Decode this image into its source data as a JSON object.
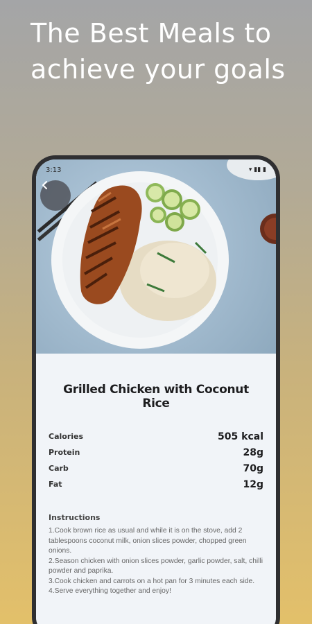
{
  "headline": "The Best Meals to achieve your goals",
  "status": {
    "time": "3:13"
  },
  "recipe": {
    "title": "Grilled Chicken with Coconut Rice",
    "nutrition": [
      {
        "label": "Calories",
        "value": "505 kcal"
      },
      {
        "label": "Protein",
        "value": "28g"
      },
      {
        "label": "Carb",
        "value": "70g"
      },
      {
        "label": "Fat",
        "value": "12g"
      }
    ],
    "instructions_title": "Instructions",
    "steps": [
      "1.Cook brown rice as usual and while it is on the stove, add 2 tablespoons coconut milk, onion slices powder, chopped green onions.",
      "2.Season chicken with onion slices powder, garlic powder, salt, chilli powder and paprika.",
      "3.Cook chicken and carrots on a hot pan for 3 minutes each side.",
      "4.Serve everything together and enjoy!"
    ]
  },
  "icons": {
    "back": "chevron-left-icon"
  },
  "colors": {
    "background_top": "#a4a5a7",
    "background_bottom": "#e3c06a",
    "screen": "#f1f4f8"
  }
}
